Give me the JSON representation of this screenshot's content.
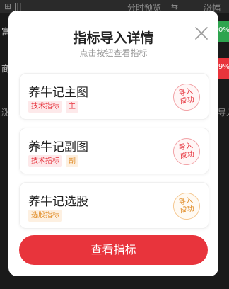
{
  "background": {
    "top_label": "分时预览",
    "top_right": "涨幅",
    "left_fragments": [
      "富",
      "商",
      "涨"
    ],
    "right_fragments": [
      "0%",
      "9%",
      "导入"
    ],
    "colors": {
      "green": "#2ea44f",
      "red": "#e8343c"
    }
  },
  "dialog": {
    "title": "指标导入详情",
    "subtitle": "点击按钮查看指标",
    "close_icon": "close-icon",
    "cards": [
      {
        "name": "养牛记主图",
        "tags": [
          {
            "text": "技术指标",
            "color": "red"
          },
          {
            "text": "主",
            "color": "red"
          }
        ],
        "stamp": {
          "line1": "导入",
          "line2": "成功",
          "color": "red"
        }
      },
      {
        "name": "养牛记副图",
        "tags": [
          {
            "text": "技术指标",
            "color": "red"
          },
          {
            "text": "副",
            "color": "orange"
          }
        ],
        "stamp": {
          "line1": "导入",
          "line2": "成功",
          "color": "red"
        }
      },
      {
        "name": "养牛记选股",
        "tags": [
          {
            "text": "选股指标",
            "color": "orange"
          }
        ],
        "stamp": {
          "line1": "导入",
          "line2": "成功",
          "color": "orange"
        }
      }
    ],
    "cta_label": "查看指标",
    "accent": "#e8343c"
  }
}
